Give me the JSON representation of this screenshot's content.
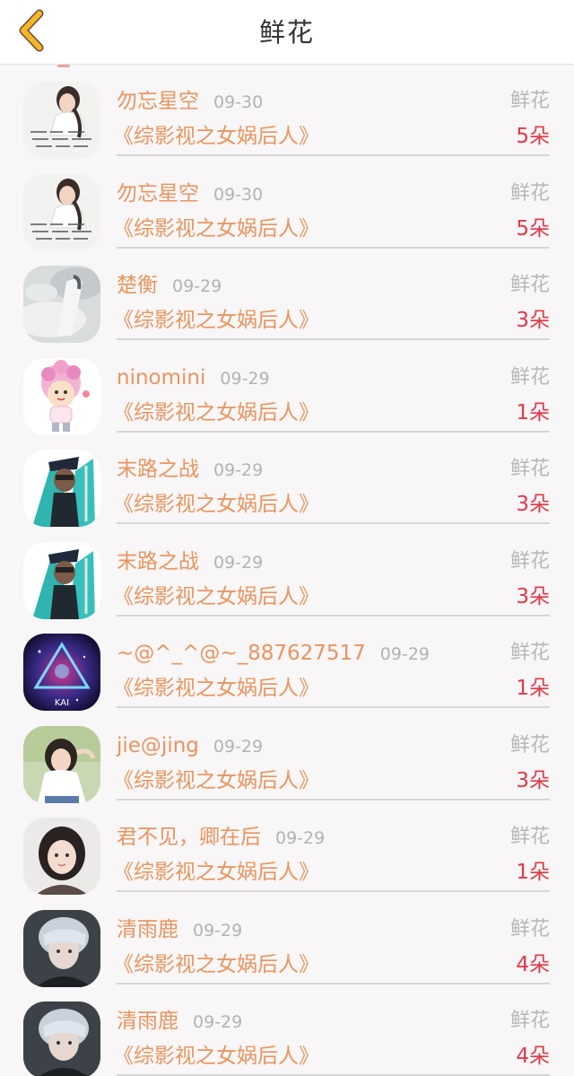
{
  "header": {
    "title": "鲜花",
    "back_icon": "chevron-left-icon",
    "back_color": "#f5b52a"
  },
  "colors": {
    "username": "#e89560",
    "amount": "#e0394b",
    "muted": "#b3b3b3"
  },
  "records": [
    {
      "user": "勿忘星空",
      "date": "09-30",
      "type": "鲜花",
      "book": "《综影视之女娲后人》",
      "amount": "5朵",
      "avatar": "handwriting-girl"
    },
    {
      "user": "勿忘星空",
      "date": "09-30",
      "type": "鲜花",
      "book": "《综影视之女娲后人》",
      "amount": "5朵",
      "avatar": "handwriting-girl"
    },
    {
      "user": "楚衡",
      "date": "09-29",
      "type": "鲜花",
      "book": "《综影视之女娲后人》",
      "amount": "3朵",
      "avatar": "misty-figure"
    },
    {
      "user": "ninomini",
      "date": "09-29",
      "type": "鲜花",
      "book": "《综影视之女娲后人》",
      "amount": "1朵",
      "avatar": "cartoon-chibi"
    },
    {
      "user": "末路之战",
      "date": "09-29",
      "type": "鲜花",
      "book": "《综影视之女娲后人》",
      "amount": "3朵",
      "avatar": "anime-teal"
    },
    {
      "user": "末路之战",
      "date": "09-29",
      "type": "鲜花",
      "book": "《综影视之女娲后人》",
      "amount": "3朵",
      "avatar": "anime-teal"
    },
    {
      "user": "~@^_^@~_887627517",
      "date": "09-29",
      "type": "鲜花",
      "book": "《综影视之女娲后人》",
      "amount": "1朵",
      "avatar": "galaxy-triangle",
      "avatar_text": "KAI"
    },
    {
      "user": "jie@jing",
      "date": "09-29",
      "type": "鲜花",
      "book": "《综影视之女娲后人》",
      "amount": "3朵",
      "avatar": "girl-outdoor"
    },
    {
      "user": "君不见，卿在后",
      "date": "09-29",
      "type": "鲜花",
      "book": "《综影视之女娲后人》",
      "amount": "1朵",
      "avatar": "girl-portrait"
    },
    {
      "user": "清雨鹿",
      "date": "09-29",
      "type": "鲜花",
      "book": "《综影视之女娲后人》",
      "amount": "4朵",
      "avatar": "silver-hair-boy"
    },
    {
      "user": "清雨鹿",
      "date": "09-29",
      "type": "鲜花",
      "book": "《综影视之女娲后人》",
      "amount": "4朵",
      "avatar": "silver-hair-boy"
    }
  ]
}
